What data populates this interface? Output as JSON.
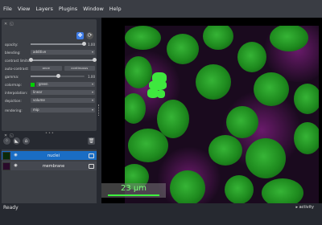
{
  "menu": [
    "File",
    "View",
    "Layers",
    "Plugins",
    "Window",
    "Help"
  ],
  "layer_controls": {
    "opacity": {
      "label": "opacity:",
      "value": "1.00",
      "level": 1.0
    },
    "blending": {
      "label": "blending:",
      "value": "additive"
    },
    "contrast_limits": {
      "label": "contrast limits:",
      "low": 0.0,
      "high": 1.0
    },
    "auto_contrast": {
      "label": "auto-contrast:",
      "once": "once",
      "continuous": "continuous"
    },
    "gamma": {
      "label": "gamma:",
      "value": "1.00",
      "level": 0.5
    },
    "colormap": {
      "label": "colormap:",
      "value": "green",
      "color": "#00d000"
    },
    "interpolation": {
      "label": "interpolation:",
      "value": "linear"
    },
    "depiction": {
      "label": "depiction:",
      "value": "volume"
    },
    "rendering": {
      "label": "rendering:",
      "value": "mip"
    }
  },
  "icons": {
    "move": "move-arrows-icon",
    "transform": "transform-icon",
    "points": "new-points-layer-icon",
    "shapes": "new-shapes-layer-icon",
    "labels": "new-labels-layer-icon",
    "delete": "trash-icon"
  },
  "layers": [
    {
      "name": "nuclei",
      "selected": true,
      "color": "#1a6dc4"
    },
    {
      "name": "membrane",
      "selected": false,
      "color": "#454850"
    }
  ],
  "scale_bar": {
    "text": "23 µm",
    "color": "#3ef03e"
  },
  "status": {
    "text": "Ready",
    "activity": "▸ activity"
  }
}
